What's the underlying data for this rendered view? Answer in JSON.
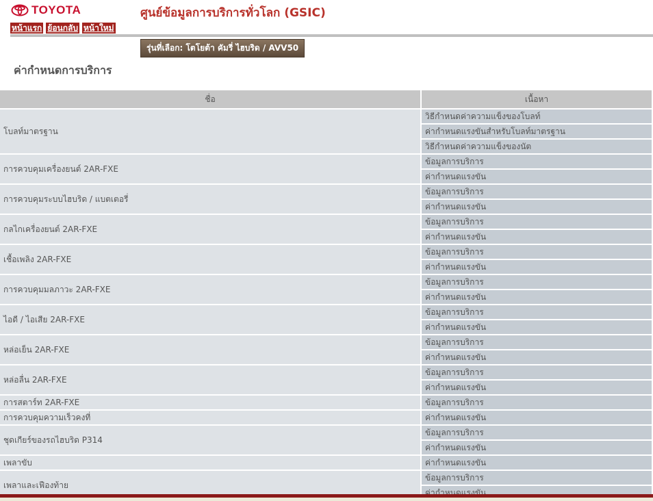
{
  "brand": {
    "logo_text": "TOYOTA",
    "color": "#c8102e"
  },
  "site_title": "ศูนย์ข้อมูลการบริการทั่วโลก (GSIC)",
  "nav": [
    "หน้าแรก",
    "ย้อนกลับ",
    "หน้าใหม่"
  ],
  "selected_model": "รุ่นที่เลือก: โตโยต้า คัมรี่ ไฮบริด / AVV50",
  "page_heading": "ค่ากำหนดการบริการ",
  "table": {
    "headers": {
      "name": "ชื่อ",
      "content": "เนื้อหา"
    },
    "groups": [
      {
        "name": "โบลท์มาตรฐาน",
        "items": [
          "วิธีกำหนดค่าความแข็งของโบลท์",
          "ค่ากำหนดแรงขันสำหรับโบลท์มาตรฐาน",
          "วิธีกำหนดค่าความแข็งของนัต"
        ]
      },
      {
        "name": "การควบคุมเครื่องยนต์ 2AR-FXE",
        "items": [
          "ข้อมูลการบริการ",
          "ค่ากำหนดแรงขัน"
        ]
      },
      {
        "name": "การควบคุมระบบไฮบริด / แบตเตอรี่",
        "items": [
          "ข้อมูลการบริการ",
          "ค่ากำหนดแรงขัน"
        ]
      },
      {
        "name": "กลไกเครื่องยนต์ 2AR-FXE",
        "items": [
          "ข้อมูลการบริการ",
          "ค่ากำหนดแรงขัน"
        ]
      },
      {
        "name": "เชื้อเพลิง 2AR-FXE",
        "items": [
          "ข้อมูลการบริการ",
          "ค่ากำหนดแรงขัน"
        ]
      },
      {
        "name": "การควบคุมมลภาวะ 2AR-FXE",
        "items": [
          "ข้อมูลการบริการ",
          "ค่ากำหนดแรงขัน"
        ]
      },
      {
        "name": "ไอดี / ไอเสีย 2AR-FXE",
        "items": [
          "ข้อมูลการบริการ",
          "ค่ากำหนดแรงขัน"
        ]
      },
      {
        "name": "หล่อเย็น 2AR-FXE",
        "items": [
          "ข้อมูลการบริการ",
          "ค่ากำหนดแรงขัน"
        ]
      },
      {
        "name": "หล่อลื่น 2AR-FXE",
        "items": [
          "ข้อมูลการบริการ",
          "ค่ากำหนดแรงขัน"
        ]
      },
      {
        "name": "การสตาร์ท 2AR-FXE",
        "items": [
          "ข้อมูลการบริการ"
        ]
      },
      {
        "name": "การควบคุมความเร็วคงที่",
        "items": [
          "ค่ากำหนดแรงขัน"
        ]
      },
      {
        "name": "ชุดเกียร์ของรถไฮบริด P314",
        "items": [
          "ข้อมูลการบริการ",
          "ค่ากำหนดแรงขัน"
        ]
      },
      {
        "name": "เพลาขับ",
        "items": [
          "ค่ากำหนดแรงขัน"
        ]
      },
      {
        "name": "เพลาและเฟืองท้าย",
        "items": [
          "ข้อมูลการบริการ",
          "ค่ากำหนดแรงขัน"
        ]
      }
    ]
  }
}
